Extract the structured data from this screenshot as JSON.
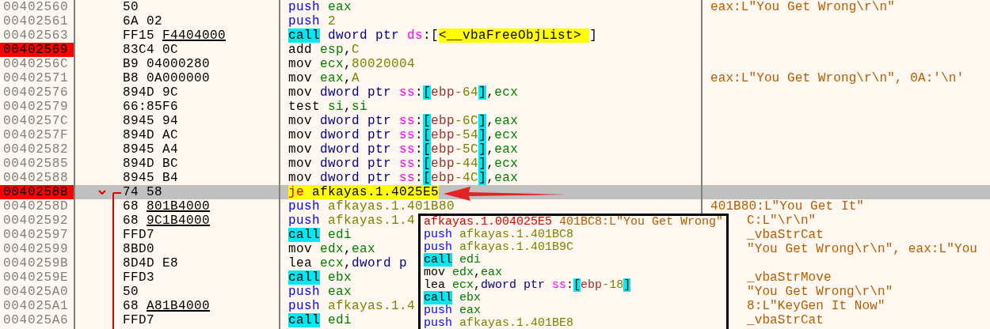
{
  "rows": [
    {
      "address": "00402560",
      "breakpoint": false,
      "current": false,
      "opcode": "50",
      "comment": "eax:L\"You Get Wrong\\r\\n\"",
      "tokens": [
        {
          "text": "push",
          "kind": "push"
        },
        {
          "text": " eax",
          "kind": "reg"
        }
      ]
    },
    {
      "address": "00402561",
      "breakpoint": false,
      "current": false,
      "opcode": "6A 02",
      "tokens": [
        {
          "text": "push",
          "kind": "push"
        },
        {
          "text": " 2",
          "kind": "num"
        }
      ]
    },
    {
      "address": "00402563",
      "breakpoint": false,
      "current": false,
      "opcode": "FF15 ",
      "operand": "F4404000",
      "tokens": [
        {
          "text": "call",
          "kind": "call"
        },
        {
          "text": " dword ptr ",
          "kind": "ptr"
        },
        {
          "text": "ds",
          "kind": "seg"
        },
        {
          "text": ":",
          "kind": "p"
        },
        {
          "text": "[",
          "kind": "p"
        },
        {
          "text": "<__vbaFreeObjList> ",
          "kind": "sym"
        },
        {
          "text": "]",
          "kind": "p"
        }
      ]
    },
    {
      "address": "00402569",
      "breakpoint": true,
      "current": false,
      "opcode": "83C4 0C",
      "tokens": [
        {
          "text": "add",
          "kind": "mnem"
        },
        {
          "text": " esp",
          "kind": "reg"
        },
        {
          "text": ",",
          "kind": "p"
        },
        {
          "text": "C",
          "kind": "num"
        }
      ]
    },
    {
      "address": "0040256C",
      "breakpoint": false,
      "current": false,
      "opcode": "B9 04000280",
      "tokens": [
        {
          "text": "mov",
          "kind": "mnem"
        },
        {
          "text": " ecx",
          "kind": "reg"
        },
        {
          "text": ",",
          "kind": "p"
        },
        {
          "text": "80020004",
          "kind": "num"
        }
      ]
    },
    {
      "address": "00402571",
      "breakpoint": false,
      "current": false,
      "opcode": "B8 0A000000",
      "comment": "eax:L\"You Get Wrong\\r\\n\", 0A:'\\n'",
      "tokens": [
        {
          "text": "mov",
          "kind": "mnem"
        },
        {
          "text": " eax",
          "kind": "reg"
        },
        {
          "text": ",",
          "kind": "p"
        },
        {
          "text": "A",
          "kind": "num"
        }
      ]
    },
    {
      "address": "00402576",
      "breakpoint": false,
      "current": false,
      "opcode": "894D 9C",
      "tokens": [
        {
          "text": "mov",
          "kind": "mnem"
        },
        {
          "text": " dword ptr ",
          "kind": "ptr"
        },
        {
          "text": "ss",
          "kind": "seg"
        },
        {
          "text": ":",
          "kind": "p"
        },
        {
          "text": "[",
          "kind": "br"
        },
        {
          "text": "ebp",
          "kind": "base"
        },
        {
          "text": "-64",
          "kind": "num"
        },
        {
          "text": "]",
          "kind": "br"
        },
        {
          "text": ",",
          "kind": "p"
        },
        {
          "text": "ecx",
          "kind": "reg"
        }
      ]
    },
    {
      "address": "00402579",
      "breakpoint": false,
      "current": false,
      "opcode": "66:85F6",
      "tokens": [
        {
          "text": "test",
          "kind": "mnem"
        },
        {
          "text": " si",
          "kind": "reg"
        },
        {
          "text": ",",
          "kind": "p"
        },
        {
          "text": "si",
          "kind": "reg"
        }
      ]
    },
    {
      "address": "0040257C",
      "breakpoint": false,
      "current": false,
      "opcode": "8945 94",
      "tokens": [
        {
          "text": "mov",
          "kind": "mnem"
        },
        {
          "text": " dword ptr ",
          "kind": "ptr"
        },
        {
          "text": "ss",
          "kind": "seg"
        },
        {
          "text": ":",
          "kind": "p"
        },
        {
          "text": "[",
          "kind": "br"
        },
        {
          "text": "ebp",
          "kind": "base"
        },
        {
          "text": "-6C",
          "kind": "num"
        },
        {
          "text": "]",
          "kind": "br"
        },
        {
          "text": ",",
          "kind": "p"
        },
        {
          "text": "eax",
          "kind": "reg"
        }
      ]
    },
    {
      "address": "0040257F",
      "breakpoint": false,
      "current": false,
      "opcode": "894D AC",
      "tokens": [
        {
          "text": "mov",
          "kind": "mnem"
        },
        {
          "text": " dword ptr ",
          "kind": "ptr"
        },
        {
          "text": "ss",
          "kind": "seg"
        },
        {
          "text": ":",
          "kind": "p"
        },
        {
          "text": "[",
          "kind": "br"
        },
        {
          "text": "ebp",
          "kind": "base"
        },
        {
          "text": "-54",
          "kind": "num"
        },
        {
          "text": "]",
          "kind": "br"
        },
        {
          "text": ",",
          "kind": "p"
        },
        {
          "text": "ecx",
          "kind": "reg"
        }
      ]
    },
    {
      "address": "00402582",
      "breakpoint": false,
      "current": false,
      "opcode": "8945 A4",
      "tokens": [
        {
          "text": "mov",
          "kind": "mnem"
        },
        {
          "text": " dword ptr ",
          "kind": "ptr"
        },
        {
          "text": "ss",
          "kind": "seg"
        },
        {
          "text": ":",
          "kind": "p"
        },
        {
          "text": "[",
          "kind": "br"
        },
        {
          "text": "ebp",
          "kind": "base"
        },
        {
          "text": "-5C",
          "kind": "num"
        },
        {
          "text": "]",
          "kind": "br"
        },
        {
          "text": ",",
          "kind": "p"
        },
        {
          "text": "eax",
          "kind": "reg"
        }
      ]
    },
    {
      "address": "00402585",
      "breakpoint": false,
      "current": false,
      "opcode": "894D BC",
      "tokens": [
        {
          "text": "mov",
          "kind": "mnem"
        },
        {
          "text": " dword ptr ",
          "kind": "ptr"
        },
        {
          "text": "ss",
          "kind": "seg"
        },
        {
          "text": ":",
          "kind": "p"
        },
        {
          "text": "[",
          "kind": "br"
        },
        {
          "text": "ebp",
          "kind": "base"
        },
        {
          "text": "-44",
          "kind": "num"
        },
        {
          "text": "]",
          "kind": "br"
        },
        {
          "text": ",",
          "kind": "p"
        },
        {
          "text": "ecx",
          "kind": "reg"
        }
      ]
    },
    {
      "address": "00402588",
      "breakpoint": false,
      "current": false,
      "opcode": "8945 B4",
      "tokens": [
        {
          "text": "mov",
          "kind": "mnem"
        },
        {
          "text": " dword ptr ",
          "kind": "ptr"
        },
        {
          "text": "ss",
          "kind": "seg"
        },
        {
          "text": ":",
          "kind": "p"
        },
        {
          "text": "[",
          "kind": "br"
        },
        {
          "text": "ebp",
          "kind": "base"
        },
        {
          "text": "-4C",
          "kind": "num"
        },
        {
          "text": "]",
          "kind": "br"
        },
        {
          "text": ",",
          "kind": "p"
        },
        {
          "text": "eax",
          "kind": "reg"
        }
      ]
    },
    {
      "address": "0040258B",
      "breakpoint": true,
      "current": true,
      "jump_start": true,
      "opcode": "74 58",
      "tokens": [
        {
          "text": "je",
          "kind": "jcc"
        },
        {
          "text": " afkayas.1.4025E5",
          "kind": "target"
        }
      ]
    },
    {
      "address": "0040258D",
      "breakpoint": false,
      "current": false,
      "opcode": "68 ",
      "operand": "801B4000",
      "comment": "401B80:L\"You Get It\"",
      "tokens": [
        {
          "text": "push",
          "kind": "push"
        },
        {
          "text": " afkayas.1.401B80",
          "kind": "num"
        }
      ]
    },
    {
      "address": "00402592",
      "breakpoint": false,
      "current": false,
      "under_popup": true,
      "opcode": "68 ",
      "operand": "9C1B4000",
      "comment": "C:L\"\\r\\n\"",
      "tokens": [
        {
          "text": "push",
          "kind": "push"
        },
        {
          "text": " afkayas.1.4",
          "kind": "num"
        }
      ]
    },
    {
      "address": "00402597",
      "breakpoint": false,
      "current": false,
      "under_popup": true,
      "opcode": "FFD7",
      "comment": "_vbaStrCat",
      "tokens": [
        {
          "text": "call",
          "kind": "call"
        },
        {
          "text": " edi",
          "kind": "reg"
        }
      ]
    },
    {
      "address": "00402599",
      "breakpoint": false,
      "current": false,
      "under_popup": true,
      "opcode": "8BD0",
      "comment": "\"You Get Wrong\\r\\n\", eax:L\"You",
      "tokens": [
        {
          "text": "mov",
          "kind": "mnem"
        },
        {
          "text": " edx",
          "kind": "reg"
        },
        {
          "text": ",",
          "kind": "p"
        },
        {
          "text": "eax",
          "kind": "reg"
        }
      ]
    },
    {
      "address": "0040259B",
      "breakpoint": false,
      "current": false,
      "opcode": "8D4D E8",
      "tokens": [
        {
          "text": "lea",
          "kind": "mnem"
        },
        {
          "text": " ecx",
          "kind": "reg"
        },
        {
          "text": ",",
          "kind": "p"
        },
        {
          "text": "dword p",
          "kind": "ptr"
        }
      ]
    },
    {
      "address": "0040259E",
      "breakpoint": false,
      "current": false,
      "under_popup": true,
      "opcode": "FFD3",
      "comment": "_vbaStrMove",
      "tokens": [
        {
          "text": "call",
          "kind": "call"
        },
        {
          "text": " ebx",
          "kind": "reg"
        }
      ]
    },
    {
      "address": "004025A0",
      "breakpoint": false,
      "current": false,
      "under_popup": true,
      "opcode": "50",
      "comment": "\"You Get Wrong\\r\\n\"",
      "tokens": [
        {
          "text": "push",
          "kind": "push"
        },
        {
          "text": " eax",
          "kind": "reg"
        }
      ]
    },
    {
      "address": "004025A1",
      "breakpoint": false,
      "current": false,
      "under_popup": true,
      "opcode": "68 ",
      "operand": "A81B4000",
      "comment": "8:L\"KeyGen It Now\"",
      "tokens": [
        {
          "text": "push",
          "kind": "push"
        },
        {
          "text": " afkayas.1.4",
          "kind": "num"
        }
      ]
    },
    {
      "address": "004025A6",
      "breakpoint": false,
      "current": false,
      "under_popup": true,
      "opcode": "FFD7",
      "comment": "_vbaStrCat",
      "tokens": [
        {
          "text": "call",
          "kind": "call"
        },
        {
          "text": " edi",
          "kind": "reg"
        }
      ]
    }
  ],
  "tooltip": {
    "target": "afkayas.1.004025E5",
    "note": "401BC8:L\"You Get Wrong\"",
    "lines": [
      [
        {
          "text": "push",
          "kind": "push"
        },
        {
          "text": " afkayas.1.401BC8",
          "kind": "num"
        }
      ],
      [
        {
          "text": "push",
          "kind": "push"
        },
        {
          "text": " afkayas.1.401B9C",
          "kind": "num"
        }
      ],
      [
        {
          "text": "call",
          "kind": "call"
        },
        {
          "text": " edi",
          "kind": "reg"
        }
      ],
      [
        {
          "text": "mov",
          "kind": "mnem"
        },
        {
          "text": " edx",
          "kind": "reg"
        },
        {
          "text": ",",
          "kind": "p"
        },
        {
          "text": "eax",
          "kind": "reg"
        }
      ],
      [
        {
          "text": "lea",
          "kind": "mnem"
        },
        {
          "text": " ecx",
          "kind": "reg"
        },
        {
          "text": ",",
          "kind": "p"
        },
        {
          "text": "dword ptr ",
          "kind": "ptr"
        },
        {
          "text": "ss",
          "kind": "seg"
        },
        {
          "text": ":",
          "kind": "p"
        },
        {
          "text": "[",
          "kind": "br"
        },
        {
          "text": "ebp",
          "kind": "base"
        },
        {
          "text": "-18",
          "kind": "num"
        },
        {
          "text": "]",
          "kind": "br"
        }
      ],
      [
        {
          "text": "call",
          "kind": "call"
        },
        {
          "text": " ebx",
          "kind": "reg"
        }
      ],
      [
        {
          "text": "push",
          "kind": "push"
        },
        {
          "text": " eax",
          "kind": "reg"
        }
      ],
      [
        {
          "text": "push",
          "kind": "push"
        },
        {
          "text": " afkayas.1.401BE8",
          "kind": "num"
        }
      ]
    ]
  }
}
